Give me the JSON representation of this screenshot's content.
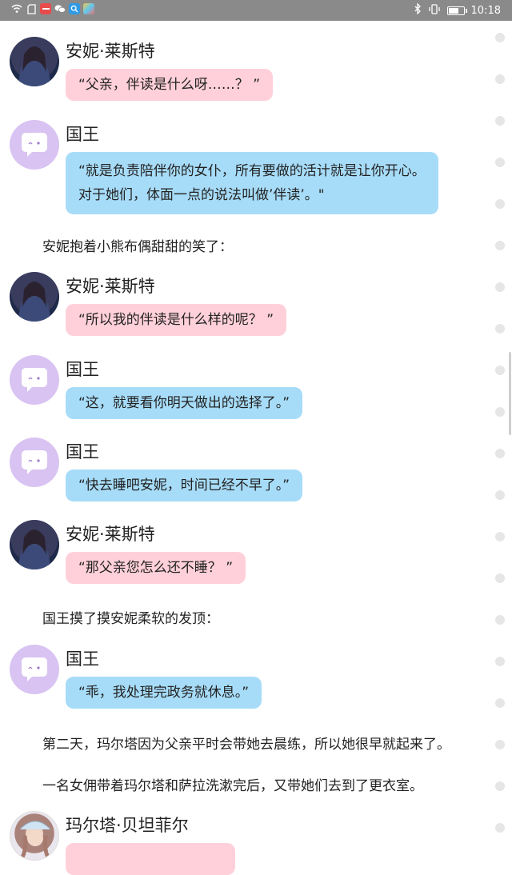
{
  "status_bar": {
    "time": "10:18",
    "left_icons": [
      "wifi-icon",
      "sd-card-icon",
      "app-badge-icon",
      "wechat-icon",
      "search-app-icon",
      "gallery-icon"
    ],
    "right_icons": [
      "bluetooth-icon",
      "vibrate-icon",
      "battery-icon"
    ],
    "battery_level": 0.75
  },
  "messages": [
    {
      "speaker": "安妮·莱斯特",
      "avatar": "anne",
      "color": "pink",
      "lines": [
        "“父亲，伴读是什么呀……？ ”"
      ]
    },
    {
      "speaker": "国王",
      "avatar": "king",
      "color": "blue",
      "lines": [
        "“就是负责陪伴你的女仆，所有要做的活计就是让你开心。",
        "对于她们，体面一点的说法叫做’伴读’。\""
      ]
    },
    {
      "narration": "安妮抱着小熊布偶甜甜的笑了："
    },
    {
      "speaker": "安妮·莱斯特",
      "avatar": "anne",
      "color": "pink",
      "lines": [
        "“所以我的伴读是什么样的呢？ ”"
      ]
    },
    {
      "speaker": "国王",
      "avatar": "king",
      "color": "blue",
      "lines": [
        "“这，就要看你明天做出的选择了。”"
      ]
    },
    {
      "speaker": "国王",
      "avatar": "king",
      "color": "blue",
      "lines": [
        "“快去睡吧安妮，时间已经不早了。”"
      ]
    },
    {
      "speaker": "安妮·莱斯特",
      "avatar": "anne",
      "color": "pink",
      "lines": [
        "“那父亲您怎么还不睡？ ”"
      ]
    },
    {
      "narration": "国王摸了摸安妮柔软的发顶："
    },
    {
      "speaker": "国王",
      "avatar": "king",
      "color": "blue",
      "lines": [
        "“乖，我处理完政务就休息。”"
      ]
    },
    {
      "narration": "第二天，玛尔塔因为父亲平时会带她去晨练，所以她很早就起来了。"
    },
    {
      "narration": "一名女佣带着玛尔塔和萨拉洗漱完后，又带她们去到了更衣室。"
    },
    {
      "speaker": "玛尔塔·贝坦菲尔",
      "avatar": "marta",
      "color": "pink",
      "lines": []
    }
  ]
}
